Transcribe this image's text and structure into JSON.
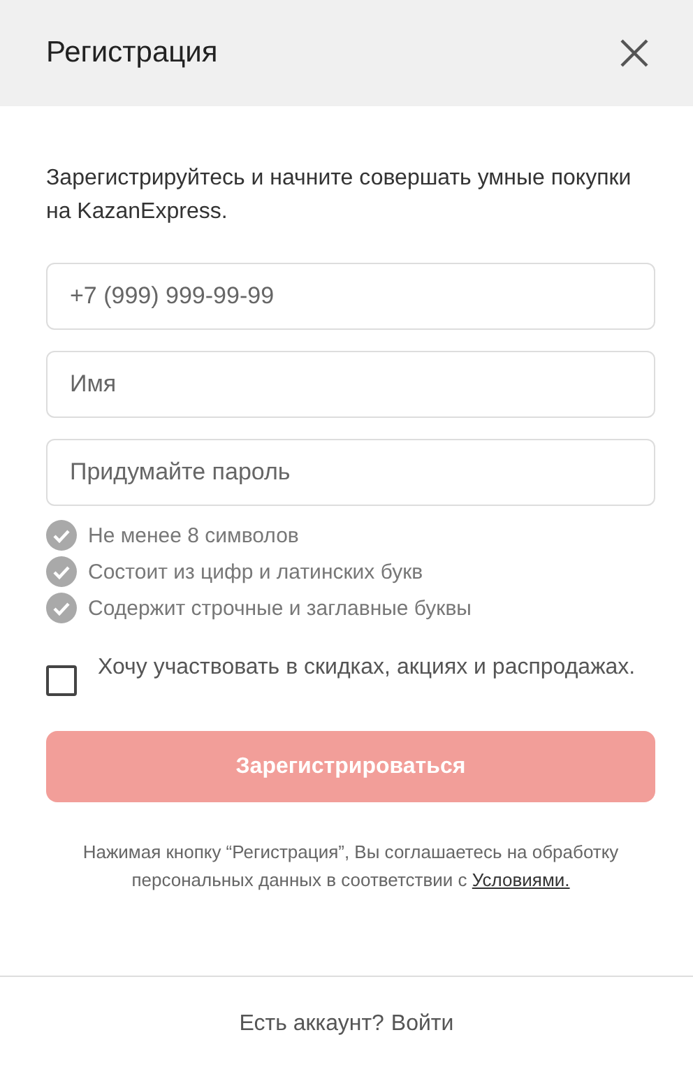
{
  "dialog": {
    "title": "Регистрация"
  },
  "intro": "Зарегистрируйтесь и начните совершать умные покупки на KazanExpress.",
  "fields": [
    {
      "placeholder": "+7 (999) 999-99-99"
    },
    {
      "placeholder": "Имя"
    },
    {
      "placeholder": "Придумайте пароль"
    }
  ],
  "requirements": [
    {
      "text": "Не менее 8 символов",
      "met": false
    },
    {
      "text": "Состоит из цифр и латинских букв",
      "met": false
    },
    {
      "text": "Содержит строчные и заглавные буквы",
      "met": false
    }
  ],
  "newsletter": {
    "label": "Хочу участвовать в скидках, акциях и распродажах.",
    "checked": false
  },
  "submit": {
    "label": "Зарегистрироваться",
    "disabled": true
  },
  "legal": {
    "text": "Нажимая кнопку “Регистрация”, Вы соглашаетесь на обработку персональных данных в соответствии с",
    "link": "Условиями."
  },
  "footer": {
    "text": "Есть аккаунт?",
    "link": "Войти"
  }
}
